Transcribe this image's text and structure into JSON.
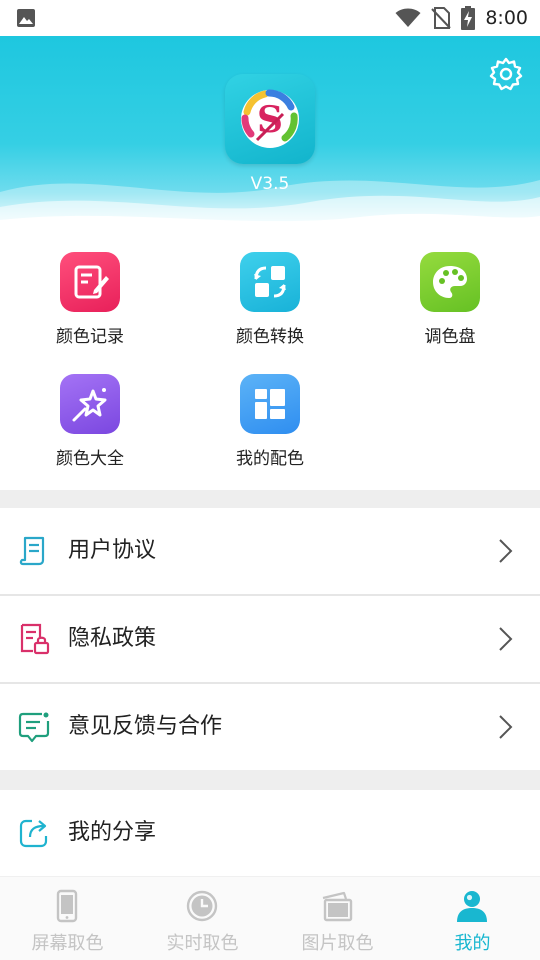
{
  "status_bar": {
    "time": "8:00"
  },
  "header": {
    "version": "V3.5",
    "accent": "#1ec7df"
  },
  "tools": [
    {
      "label": "颜色记录",
      "icon": "edit-note-icon",
      "color": "#f1356a"
    },
    {
      "label": "颜色转换",
      "icon": "convert-icon",
      "color": "#22bfe0"
    },
    {
      "label": "调色盘",
      "icon": "palette-icon",
      "color": "#7fcf2e"
    },
    {
      "label": "颜色大全",
      "icon": "star-wand-icon",
      "color": "#8b5ae8"
    },
    {
      "label": "我的配色",
      "icon": "layout-grid-icon",
      "color": "#3e9ef3"
    }
  ],
  "menu": [
    {
      "label": "用户协议",
      "icon": "document-icon"
    },
    {
      "label": "隐私政策",
      "icon": "privacy-lock-icon"
    },
    {
      "label": "意见反馈与合作",
      "icon": "feedback-icon"
    },
    {
      "label": "我的分享",
      "icon": "share-icon"
    }
  ],
  "bottom_nav": [
    {
      "label": "屏幕取色",
      "icon": "phone-icon",
      "active": false
    },
    {
      "label": "实时取色",
      "icon": "clock-icon",
      "active": false
    },
    {
      "label": "图片取色",
      "icon": "picture-icon",
      "active": false
    },
    {
      "label": "我的",
      "icon": "person-icon",
      "active": true
    }
  ]
}
